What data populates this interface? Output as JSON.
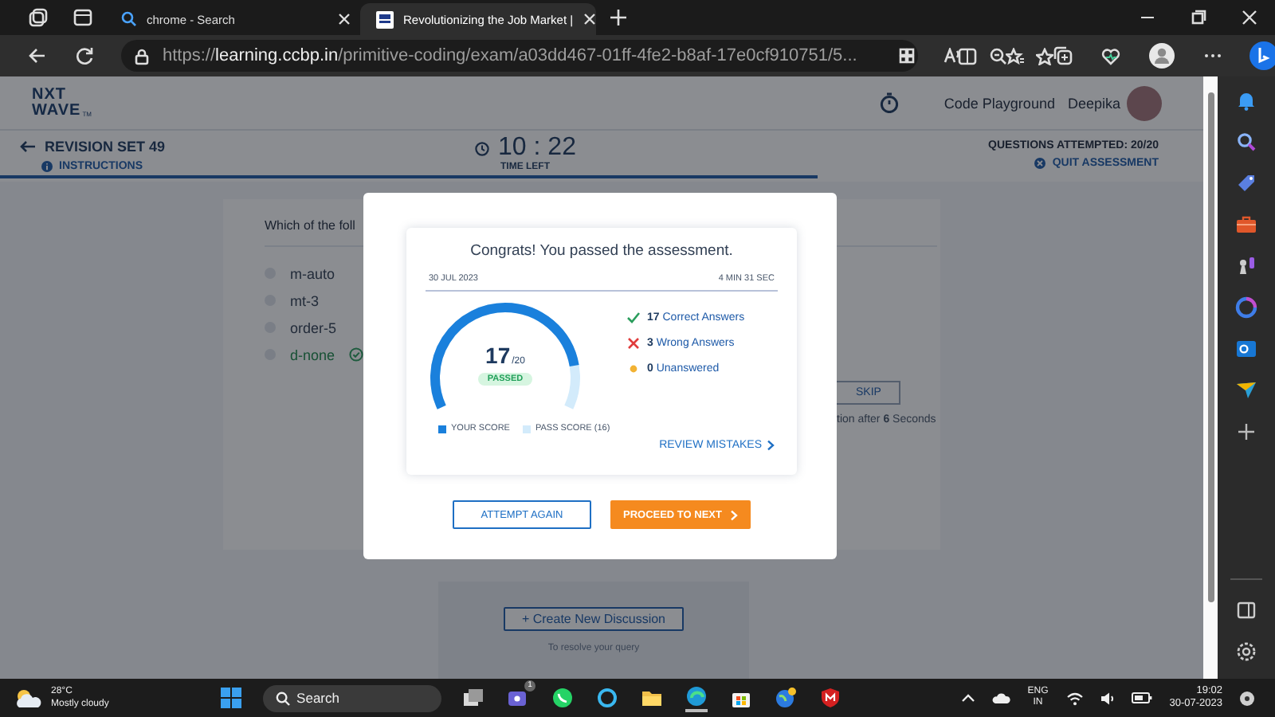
{
  "browser": {
    "tabs": [
      {
        "title": "chrome - Search",
        "selected": false
      },
      {
        "title": "Revolutionizing the Job Market |",
        "selected": true
      }
    ],
    "address": {
      "scheme": "https://",
      "host": "learning.ccbp.in",
      "path": "/primitive-coding/exam/a03dd467-01ff-4fe2-b8af-17e0cf910751/5..."
    }
  },
  "header": {
    "logo": [
      "NXT",
      "WAVE"
    ],
    "logo_mark": "TM",
    "nav_link": "Code Playground",
    "user": "Deepika"
  },
  "exam_bar": {
    "title": "REVISION SET 49",
    "instructions": "INSTRUCTIONS",
    "timer": "10 : 22",
    "timer_label": "TIME LEFT",
    "attempted": "QUESTIONS ATTEMPTED: 20/20",
    "quit": "QUIT ASSESSMENT",
    "progress": {
      "level": 0.68
    }
  },
  "question": {
    "text": "Which of the foll",
    "options": [
      {
        "label": "m-auto",
        "correct": false
      },
      {
        "label": "mt-3",
        "correct": false
      },
      {
        "label": "order-5",
        "correct": false
      },
      {
        "label": "d-none",
        "correct": true
      }
    ],
    "skip": "SKIP",
    "skip_note": "tion after **6** Seconds"
  },
  "discussion": {
    "button": "+ Create New Discussion",
    "hint": "To resolve your query"
  },
  "result_modal": {
    "title": "Congrats! You passed the assessment.",
    "date": "30 JUL 2023",
    "duration": "4 MIN 31 SEC",
    "score": {
      "value": "17",
      "total": "/20",
      "level": 0.85,
      "status": "PASSED"
    },
    "stats": [
      {
        "kind": "correct",
        "count": "17",
        "label": "Correct Answers"
      },
      {
        "kind": "wrong",
        "count": "3",
        "label": "Wrong Answers"
      },
      {
        "kind": "unanswered",
        "count": "0",
        "label": "Unanswered"
      }
    ],
    "legend": [
      {
        "kind": "score",
        "label": "YOUR SCORE"
      },
      {
        "kind": "pass",
        "label": "PASS SCORE (16)"
      }
    ],
    "review": "REVIEW MISTAKES",
    "buttons": [
      {
        "kind": "outline",
        "label": "ATTEMPT AGAIN"
      },
      {
        "kind": "primary",
        "label": "PROCEED TO NEXT"
      }
    ]
  },
  "taskbar": {
    "weather": {
      "temp": "28°C",
      "condition": "Mostly cloudy"
    },
    "search": {
      "placeholder": "Search"
    },
    "chat_badge": "1",
    "language": [
      "ENG",
      "IN"
    ],
    "time": "19:02",
    "date": "30-07-2023"
  }
}
